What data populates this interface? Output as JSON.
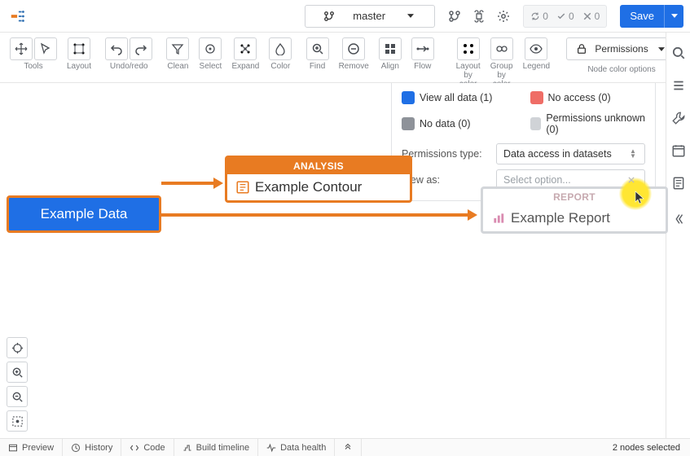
{
  "colors": {
    "accent_orange": "#e87b22",
    "accent_blue": "#1f6fe5",
    "swatch_view_all": "#1f6fe5",
    "swatch_no_access": "#ef6d66",
    "swatch_no_data": "#8e9299",
    "swatch_unknown": "#d0d3d7"
  },
  "top": {
    "branch": "master",
    "counts": {
      "refresh": "0",
      "check": "0",
      "x": "0"
    },
    "save_label": "Save"
  },
  "toolbar": {
    "groups": [
      {
        "id": "tools",
        "label": "Tools",
        "icons": [
          "move-icon",
          "pointer-arrow-icon"
        ]
      },
      {
        "id": "layout",
        "label": "Layout",
        "icons": [
          "layout-auto-icon"
        ]
      },
      {
        "id": "undo",
        "label": "Undo/redo",
        "icons": [
          "undo-icon",
          "redo-icon"
        ]
      },
      {
        "id": "clean",
        "label": "Clean",
        "icons": [
          "filter-icon"
        ]
      },
      {
        "id": "select",
        "label": "Select",
        "icons": [
          "target-icon"
        ]
      },
      {
        "id": "expand",
        "label": "Expand",
        "icons": [
          "expand-nodes-icon"
        ]
      },
      {
        "id": "color",
        "label": "Color",
        "icons": [
          "droplet-icon"
        ]
      },
      {
        "id": "find",
        "label": "Find",
        "icons": [
          "zoom-in-icon"
        ]
      },
      {
        "id": "remove",
        "label": "Remove",
        "icons": [
          "remove-circle-icon"
        ]
      },
      {
        "id": "align",
        "label": "Align",
        "icons": [
          "grid-icon"
        ]
      },
      {
        "id": "flow",
        "label": "Flow",
        "icons": [
          "flow-right-icon"
        ]
      },
      {
        "id": "lbc",
        "label": "Layout\nby color",
        "icons": [
          "layout-color-icon"
        ]
      },
      {
        "id": "gbc",
        "label": "Group\nby color",
        "icons": [
          "group-color-icon"
        ]
      },
      {
        "id": "legend",
        "label": "Legend",
        "icons": [
          "eye-icon"
        ]
      }
    ],
    "permissions_label": "Permissions",
    "node_color_label": "Node color options"
  },
  "perm_panel": {
    "legend": [
      {
        "label": "View all data (1)",
        "color": "#1f6fe5"
      },
      {
        "label": "No access (0)",
        "color": "#ef6d66"
      },
      {
        "label": "No data (0)",
        "color": "#8e9299"
      },
      {
        "label": "Permissions unknown (0)",
        "color": "#d0d3d7"
      }
    ],
    "type_label": "Permissions type:",
    "type_value": "Data access in datasets",
    "view_as_label": "View as:",
    "view_as_placeholder": "Select option..."
  },
  "nodes": {
    "data": {
      "title": "Example Data"
    },
    "analysis": {
      "header": "ANALYSIS",
      "title": "Example Contour"
    },
    "report": {
      "header": "REPORT",
      "title": "Example Report"
    }
  },
  "bottom": {
    "tabs": [
      {
        "id": "preview",
        "label": "Preview",
        "icon": "window-icon"
      },
      {
        "id": "history",
        "label": "History",
        "icon": "history-icon"
      },
      {
        "id": "code",
        "label": "Code",
        "icon": "code-icon"
      },
      {
        "id": "timeline",
        "label": "Build timeline",
        "icon": "timeline-icon"
      },
      {
        "id": "health",
        "label": "Data health",
        "icon": "pulse-icon"
      }
    ],
    "expand_icon": "chevron-up-double-icon",
    "status": "2 nodes selected"
  }
}
